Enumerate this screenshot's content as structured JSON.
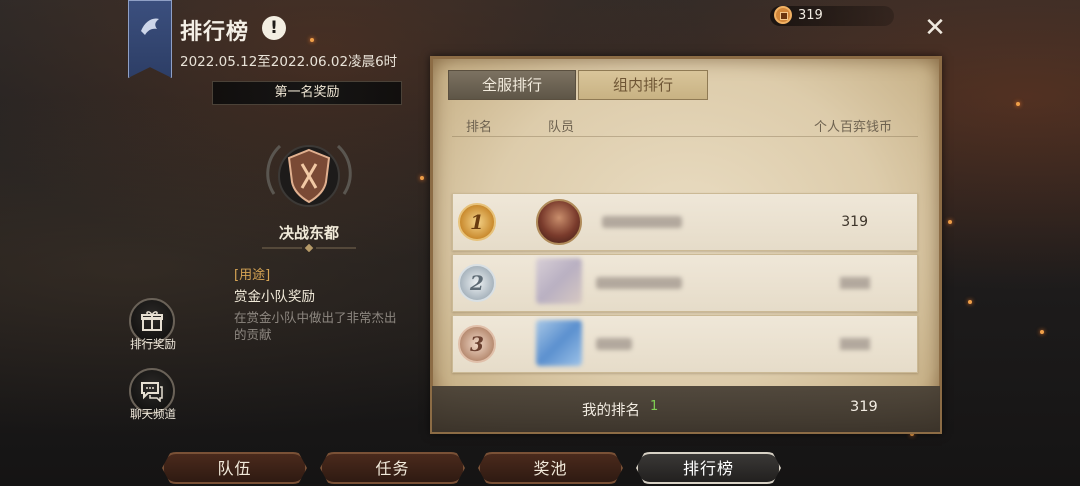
{
  "header": {
    "title": "排行榜",
    "period": "2022.05.12至2022.06.02凌晨6时",
    "first_reward_label": "第一名奖励"
  },
  "reward": {
    "name": "决战东都",
    "usage_label": "[用途]",
    "usage_value": "赏金小队奖励",
    "description": "在赏金小队中做出了非常杰出的贡献"
  },
  "side_buttons": {
    "rank_reward": "排行奖励",
    "chat_channel": "聊天频道"
  },
  "currency": {
    "value": "319"
  },
  "leaderboard": {
    "tabs": [
      "全服排行",
      "组内排行"
    ],
    "active_tab_index": 1,
    "columns": [
      "排名",
      "队员",
      "个人百弈钱币"
    ],
    "rows": [
      {
        "rank": "1",
        "coins": "319"
      },
      {
        "rank": "2",
        "coins": ""
      },
      {
        "rank": "3",
        "coins": ""
      }
    ],
    "my_rank": {
      "label": "我的排名",
      "value": "1",
      "coins": "319"
    }
  },
  "bottom_tabs": [
    "队伍",
    "任务",
    "奖池",
    "排行榜"
  ],
  "bottom_active_index": 3,
  "colors": {
    "accent_gold": "#d6a454",
    "my_rank_green": "#7fcf54",
    "parchment": "#e6dcc9"
  }
}
